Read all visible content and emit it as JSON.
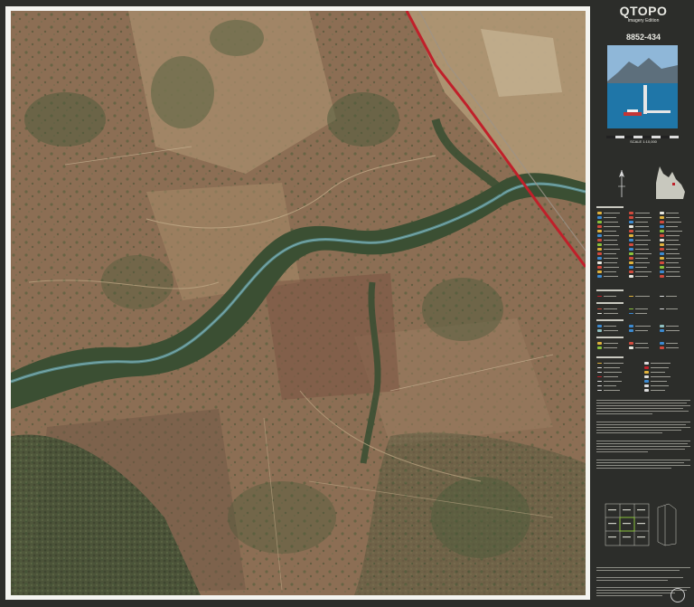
{
  "panel": {
    "brand": "QTOPO",
    "edition": "Imagery Edition",
    "sheet_number": "8852-434",
    "scale_text": "SCALE 1:10,000"
  },
  "map": {
    "features": [
      "river-corridor",
      "railway-line",
      "vegetation-patches",
      "tracks"
    ],
    "colors": {
      "terrain": "#8c6e54",
      "vegetation": "#3f5a36",
      "river": "#5c8f92",
      "railway": "#c0202a",
      "paddock": "#b29a77"
    }
  },
  "icons": [
    "north-arrow-icon",
    "queensland-locator-icon",
    "government-crest-icon"
  ]
}
